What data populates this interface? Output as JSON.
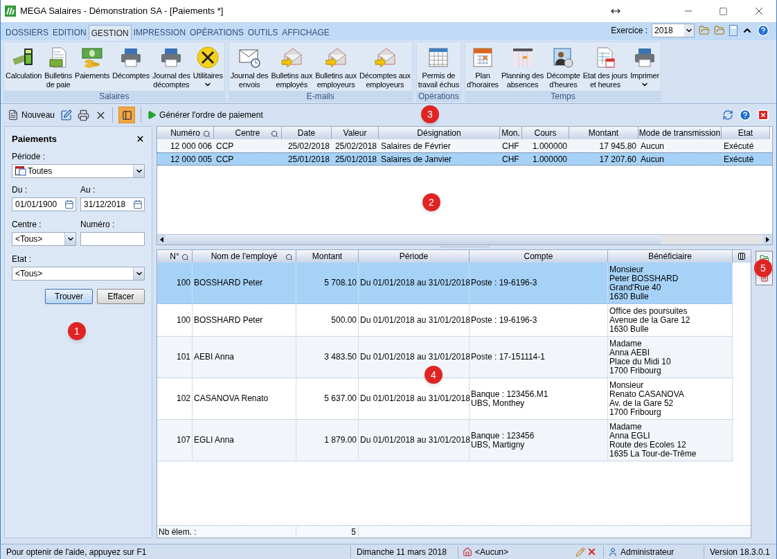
{
  "window": {
    "title": "MEGA Salaires - Démonstration SA - [Paiements *]"
  },
  "ribbon_tabs": [
    {
      "label": "DOSSIERS",
      "selected": false
    },
    {
      "label": "EDITION",
      "selected": false
    },
    {
      "label": "GESTION",
      "selected": true
    },
    {
      "label": "IMPRESSION",
      "selected": false
    },
    {
      "label": "OPÉRATIONS",
      "selected": false
    },
    {
      "label": "OUTILS",
      "selected": false
    },
    {
      "label": "AFFICHAGE",
      "selected": false
    }
  ],
  "exercice": {
    "label": "Exercice :",
    "value": "2018"
  },
  "ribbon_groups": [
    {
      "title": "Salaires",
      "buttons": [
        {
          "lines": [
            "Calculation"
          ],
          "menu": false
        },
        {
          "lines": [
            "Bulletins",
            "de paie"
          ],
          "menu": false
        },
        {
          "lines": [
            "Paiements"
          ],
          "menu": false
        },
        {
          "lines": [
            "Décomptes"
          ],
          "menu": false
        },
        {
          "lines": [
            "Journal des",
            "décomptes"
          ],
          "menu": false
        },
        {
          "lines": [
            "Utilitaires"
          ],
          "menu": true
        }
      ]
    },
    {
      "title": "E-mails",
      "buttons": [
        {
          "lines": [
            "Journal des",
            "envois"
          ],
          "menu": false
        },
        {
          "lines": [
            "Bulletins aux",
            "employés"
          ],
          "menu": false
        },
        {
          "lines": [
            "Bulletins aux",
            "employeurs"
          ],
          "menu": false
        },
        {
          "lines": [
            "Décomptes aux",
            "employeurs"
          ],
          "menu": false
        }
      ]
    },
    {
      "title": "Opérations",
      "buttons": [
        {
          "lines": [
            "Permis de",
            "travail échus"
          ],
          "menu": false
        }
      ]
    },
    {
      "title": "Temps",
      "buttons": [
        {
          "lines": [
            "Plan",
            "d'horaires"
          ],
          "menu": false
        },
        {
          "lines": [
            "Planning des",
            "absences"
          ],
          "menu": false
        },
        {
          "lines": [
            "Décompte",
            "d'heures"
          ],
          "menu": false
        },
        {
          "lines": [
            "Etat des jours",
            "et heures"
          ],
          "menu": false
        },
        {
          "lines": [
            "Imprimer"
          ],
          "menu": true
        }
      ]
    }
  ],
  "toolbar": {
    "new_label": "Nouveau",
    "panel_toggle": {
      "on": true
    },
    "generate_label": "Générer l'ordre de paiement"
  },
  "filter_panel": {
    "title": "Paiements",
    "period": {
      "label": "Période :",
      "value": "Toutes"
    },
    "from": {
      "label": "Du :",
      "value": "01/01/1900"
    },
    "to": {
      "label": "Au :",
      "value": "31/12/2018"
    },
    "centre": {
      "label": "Centre :",
      "value": "<Tous>"
    },
    "number": {
      "label": "Numéro :"
    },
    "state": {
      "label": "Etat :",
      "value": "<Tous>"
    },
    "buttons": [
      "Trouver",
      "Effacer"
    ]
  },
  "payments_table": {
    "columns": [
      {
        "label": "Numéro",
        "searchable": true
      },
      {
        "label": "Centre",
        "searchable": true
      },
      {
        "label": "Date",
        "searchable": false
      },
      {
        "label": "Valeur",
        "searchable": false
      },
      {
        "label": "Désignation",
        "searchable": false
      },
      {
        "label": "Mon.",
        "searchable": false
      },
      {
        "label": "Cours",
        "searchable": false
      },
      {
        "label": "Montant",
        "searchable": false
      },
      {
        "label": "Mode de transmission",
        "searchable": false
      },
      {
        "label": "Etat",
        "searchable": false
      }
    ],
    "rows": [
      {
        "selected": false,
        "cells": [
          "12 000 006",
          "CCP",
          "25/02/2018",
          "25/02/2018",
          "Salaires de Février",
          "CHF",
          "1.000000",
          "17 945.80",
          "Aucun",
          "Exécuté"
        ]
      },
      {
        "selected": true,
        "cells": [
          "12 000 005",
          "CCP",
          "25/01/2018",
          "25/01/2018",
          "Salaires de Janvier",
          "CHF",
          "1.000000",
          "17 207.60",
          "Aucun",
          "Exécuté"
        ]
      }
    ]
  },
  "details_table": {
    "columns": [
      {
        "label": "N°",
        "searchable": true
      },
      {
        "label": "Nom de l'employé",
        "searchable": true
      },
      {
        "label": "Montant",
        "searchable": false
      },
      {
        "label": "Période",
        "searchable": false
      },
      {
        "label": "Compte",
        "searchable": false
      },
      {
        "label": "Bénéficiaire",
        "searchable": false
      }
    ],
    "rows": [
      {
        "selected": true,
        "cells": [
          [
            "100"
          ],
          [
            "BOSSHARD Peter"
          ],
          [
            "5 708.10"
          ],
          [
            "Du 01/01/2018 au 31/01/2018"
          ],
          [
            "Poste : 19-6196-3"
          ],
          [
            "Monsieur",
            "Peter BOSSHARD",
            "Grand'Rue 40",
            "1630 Bulle"
          ]
        ]
      },
      {
        "selected": false,
        "cells": [
          [
            "100"
          ],
          [
            "BOSSHARD Peter"
          ],
          [
            "500.00"
          ],
          [
            "Du 01/01/2018 au 31/01/2018"
          ],
          [
            "Poste : 19-6196-3"
          ],
          [
            "Office des poursuites",
            "Avenue de la Gare 12",
            "1630 Bulle"
          ]
        ]
      },
      {
        "selected": false,
        "cells": [
          [
            "101"
          ],
          [
            "AEBI Anna"
          ],
          [
            "3 483.50"
          ],
          [
            "Du 01/01/2018 au 31/01/2018"
          ],
          [
            "Poste : 17-151114-1"
          ],
          [
            "Madame",
            "Anna AEBI",
            "Place du Midi 10",
            "1700 Fribourg"
          ]
        ]
      },
      {
        "selected": false,
        "cells": [
          [
            "102"
          ],
          [
            "CASANOVA Renato"
          ],
          [
            "5 637.00"
          ],
          [
            "Du 01/01/2018 au 31/01/2018"
          ],
          [
            "Banque : 123456.M1",
            "UBS, Monthey"
          ],
          [
            "Monsieur",
            "Renato CASANOVA",
            "Av. de la Gare 52",
            "1700 Fribourg"
          ]
        ]
      },
      {
        "selected": false,
        "cells": [
          [
            "107"
          ],
          [
            "EGLI Anna"
          ],
          [
            "1 879.00"
          ],
          [
            "Du 01/01/2018 au 31/01/2018"
          ],
          [
            "Banque : 123456",
            "UBS, Martigny"
          ],
          [
            "Madame",
            "Anna EGLI",
            "Route des Ecoles 12",
            "1635 La Tour-de-Trême"
          ]
        ]
      }
    ],
    "footer": {
      "label": "Nb élem. :",
      "count": "5"
    }
  },
  "status_bar": [
    "Pour optenir de l'aide, appuyez sur F1",
    "Dimanche 11 mars 2018",
    "<Aucun>",
    "Administrateur",
    "Version 18.3.0.1"
  ],
  "callouts": [
    "3",
    "2",
    "5",
    "1",
    "4"
  ]
}
